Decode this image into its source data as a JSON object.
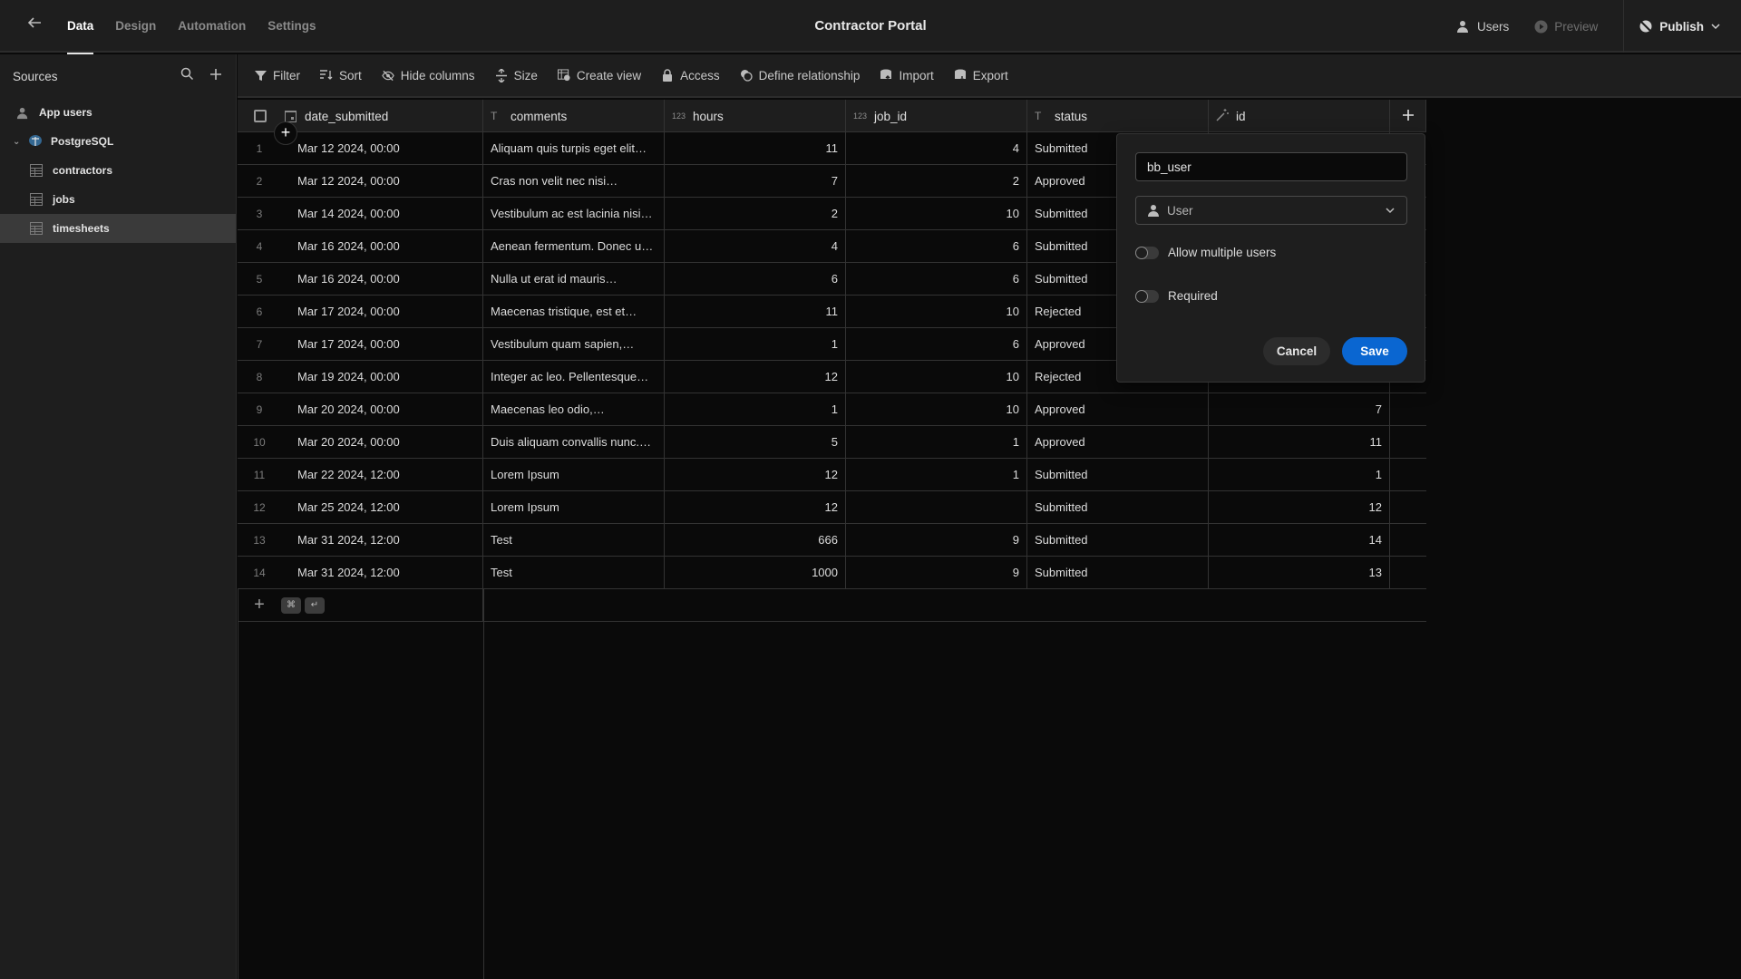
{
  "topbar": {
    "back_icon": "arrow-left-icon",
    "tabs": [
      {
        "label": "Data",
        "active": true
      },
      {
        "label": "Design",
        "active": false
      },
      {
        "label": "Automation",
        "active": false
      },
      {
        "label": "Settings",
        "active": false
      }
    ],
    "app_title": "Contractor Portal",
    "users_label": "Users",
    "preview_label": "Preview",
    "publish_label": "Publish"
  },
  "sidebar": {
    "title": "Sources",
    "app_users_label": "App users",
    "datasource_label": "PostgreSQL",
    "tables": [
      {
        "label": "contractors",
        "selected": false
      },
      {
        "label": "jobs",
        "selected": false
      },
      {
        "label": "timesheets",
        "selected": true
      }
    ]
  },
  "toolbar": {
    "items": [
      {
        "label": "Filter",
        "icon": "filter-icon"
      },
      {
        "label": "Sort",
        "icon": "sort-icon"
      },
      {
        "label": "Hide columns",
        "icon": "eye-off-icon"
      },
      {
        "label": "Size",
        "icon": "resize-icon"
      },
      {
        "label": "Create view",
        "icon": "create-view-icon"
      },
      {
        "label": "Access",
        "icon": "lock-icon"
      },
      {
        "label": "Define relationship",
        "icon": "relationship-icon"
      },
      {
        "label": "Import",
        "icon": "import-icon"
      },
      {
        "label": "Export",
        "icon": "export-icon"
      }
    ]
  },
  "table": {
    "columns": [
      {
        "name": "date_submitted",
        "type": "datetime"
      },
      {
        "name": "comments",
        "type": "text"
      },
      {
        "name": "hours",
        "type": "number"
      },
      {
        "name": "job_id",
        "type": "number"
      },
      {
        "name": "status",
        "type": "text"
      },
      {
        "name": "id",
        "type": "autonumber"
      }
    ],
    "number_type_label": "123",
    "rows": [
      {
        "n": "1",
        "date_submitted": "Mar 12 2024, 00:00",
        "comments": "Aliquam quis turpis eget elit…",
        "hours": "11",
        "job_id": "4",
        "status": "Submitted",
        "id": ""
      },
      {
        "n": "2",
        "date_submitted": "Mar 12 2024, 00:00",
        "comments": "Cras non velit nec nisi…",
        "hours": "7",
        "job_id": "2",
        "status": "Approved",
        "id": ""
      },
      {
        "n": "3",
        "date_submitted": "Mar 14 2024, 00:00",
        "comments": "Vestibulum ac est lacinia nisi…",
        "hours": "2",
        "job_id": "10",
        "status": "Submitted",
        "id": ""
      },
      {
        "n": "4",
        "date_submitted": "Mar 16 2024, 00:00",
        "comments": "Aenean fermentum. Donec u…",
        "hours": "4",
        "job_id": "6",
        "status": "Submitted",
        "id": ""
      },
      {
        "n": "5",
        "date_submitted": "Mar 16 2024, 00:00",
        "comments": "Nulla ut erat id mauris…",
        "hours": "6",
        "job_id": "6",
        "status": "Submitted",
        "id": ""
      },
      {
        "n": "6",
        "date_submitted": "Mar 17 2024, 00:00",
        "comments": "Maecenas tristique, est et…",
        "hours": "11",
        "job_id": "10",
        "status": "Rejected",
        "id": ""
      },
      {
        "n": "7",
        "date_submitted": "Mar 17 2024, 00:00",
        "comments": "Vestibulum quam sapien,…",
        "hours": "1",
        "job_id": "6",
        "status": "Approved",
        "id": ""
      },
      {
        "n": "8",
        "date_submitted": "Mar 19 2024, 00:00",
        "comments": "Integer ac leo. Pellentesque…",
        "hours": "12",
        "job_id": "10",
        "status": "Rejected",
        "id": ""
      },
      {
        "n": "9",
        "date_submitted": "Mar 20 2024, 00:00",
        "comments": "Maecenas leo odio,…",
        "hours": "1",
        "job_id": "10",
        "status": "Approved",
        "id": "7"
      },
      {
        "n": "10",
        "date_submitted": "Mar 20 2024, 00:00",
        "comments": "Duis aliquam convallis nunc.…",
        "hours": "5",
        "job_id": "1",
        "status": "Approved",
        "id": "11"
      },
      {
        "n": "11",
        "date_submitted": "Mar 22 2024, 12:00",
        "comments": "Lorem Ipsum",
        "hours": "12",
        "job_id": "1",
        "status": "Submitted",
        "id": "1"
      },
      {
        "n": "12",
        "date_submitted": "Mar 25 2024, 12:00",
        "comments": "Lorem Ipsum",
        "hours": "12",
        "job_id": "",
        "status": "Submitted",
        "id": "12"
      },
      {
        "n": "13",
        "date_submitted": "Mar 31 2024, 12:00",
        "comments": "Test",
        "hours": "666",
        "job_id": "9",
        "status": "Submitted",
        "id": "14"
      },
      {
        "n": "14",
        "date_submitted": "Mar 31 2024, 12:00",
        "comments": "Test",
        "hours": "1000",
        "job_id": "9",
        "status": "Submitted",
        "id": "13"
      }
    ],
    "shortcut_keys": [
      "⌘",
      "↵"
    ]
  },
  "popover": {
    "column_name_value": "bb_user",
    "type_select_value": "User",
    "allow_multiple_label": "Allow multiple users",
    "allow_multiple_on": false,
    "required_label": "Required",
    "required_on": false,
    "cancel_label": "Cancel",
    "save_label": "Save"
  },
  "colors": {
    "background": "#0a0a0a",
    "panel": "#1e1e1e",
    "accent": "#0a66d1"
  }
}
